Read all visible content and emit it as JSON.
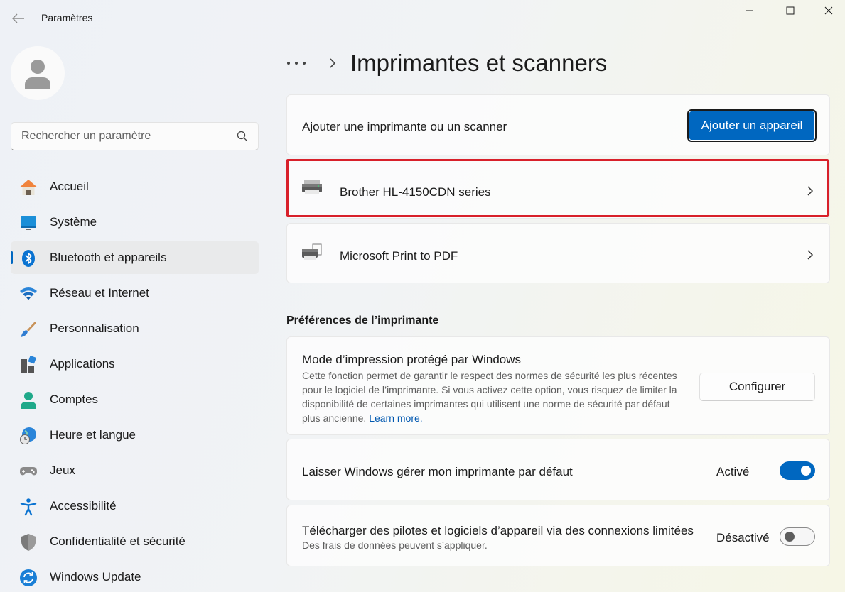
{
  "window": {
    "title": "Paramètres"
  },
  "search": {
    "placeholder": "Rechercher un paramètre"
  },
  "sidebar": {
    "items": [
      {
        "label": "Accueil",
        "icon": "home-icon"
      },
      {
        "label": "Système",
        "icon": "monitor-icon"
      },
      {
        "label": "Bluetooth et appareils",
        "icon": "bluetooth-icon",
        "active": true
      },
      {
        "label": "Réseau et Internet",
        "icon": "wifi-icon"
      },
      {
        "label": "Personnalisation",
        "icon": "brush-icon"
      },
      {
        "label": "Applications",
        "icon": "apps-icon"
      },
      {
        "label": "Comptes",
        "icon": "person-icon"
      },
      {
        "label": "Heure et langue",
        "icon": "globe-clock-icon"
      },
      {
        "label": "Jeux",
        "icon": "gamepad-icon"
      },
      {
        "label": "Accessibilité",
        "icon": "accessibility-icon"
      },
      {
        "label": "Confidentialité et sécurité",
        "icon": "shield-icon"
      },
      {
        "label": "Windows Update",
        "icon": "update-icon"
      }
    ]
  },
  "breadcrumb": {
    "more": "•••",
    "title": "Imprimantes et scanners"
  },
  "add_device": {
    "label": "Ajouter une imprimante ou un scanner",
    "button": "Ajouter un appareil"
  },
  "devices": [
    {
      "name": "Brother HL-4150CDN series",
      "icon": "printer-icon"
    },
    {
      "name": "Microsoft Print to PDF",
      "icon": "pdf-printer-icon"
    }
  ],
  "preferences": {
    "section_title": "Préférences de l’imprimante",
    "protected_mode": {
      "title": "Mode d’impression protégé par Windows",
      "description": "Cette fonction permet de garantir le respect des normes de sécurité les plus récentes pour le logiciel de l’imprimante. Si vous activez cette option, vous risquez de limiter la disponibilité de certaines imprimantes qui utilisent une norme de sécurité par défaut plus ancienne.",
      "link": "Learn more.",
      "button": "Configurer"
    },
    "default_printer": {
      "label": "Laisser Windows gérer mon imprimante par défaut",
      "state": "Activé",
      "on": true
    },
    "metered": {
      "label": "Télécharger des pilotes et logiciels d’appareil via des connexions limitées",
      "sub": "Des frais de données peuvent s’appliquer.",
      "state": "Désactivé",
      "on": false
    }
  },
  "colors": {
    "accent": "#0067c0",
    "highlight": "#d8202a"
  }
}
